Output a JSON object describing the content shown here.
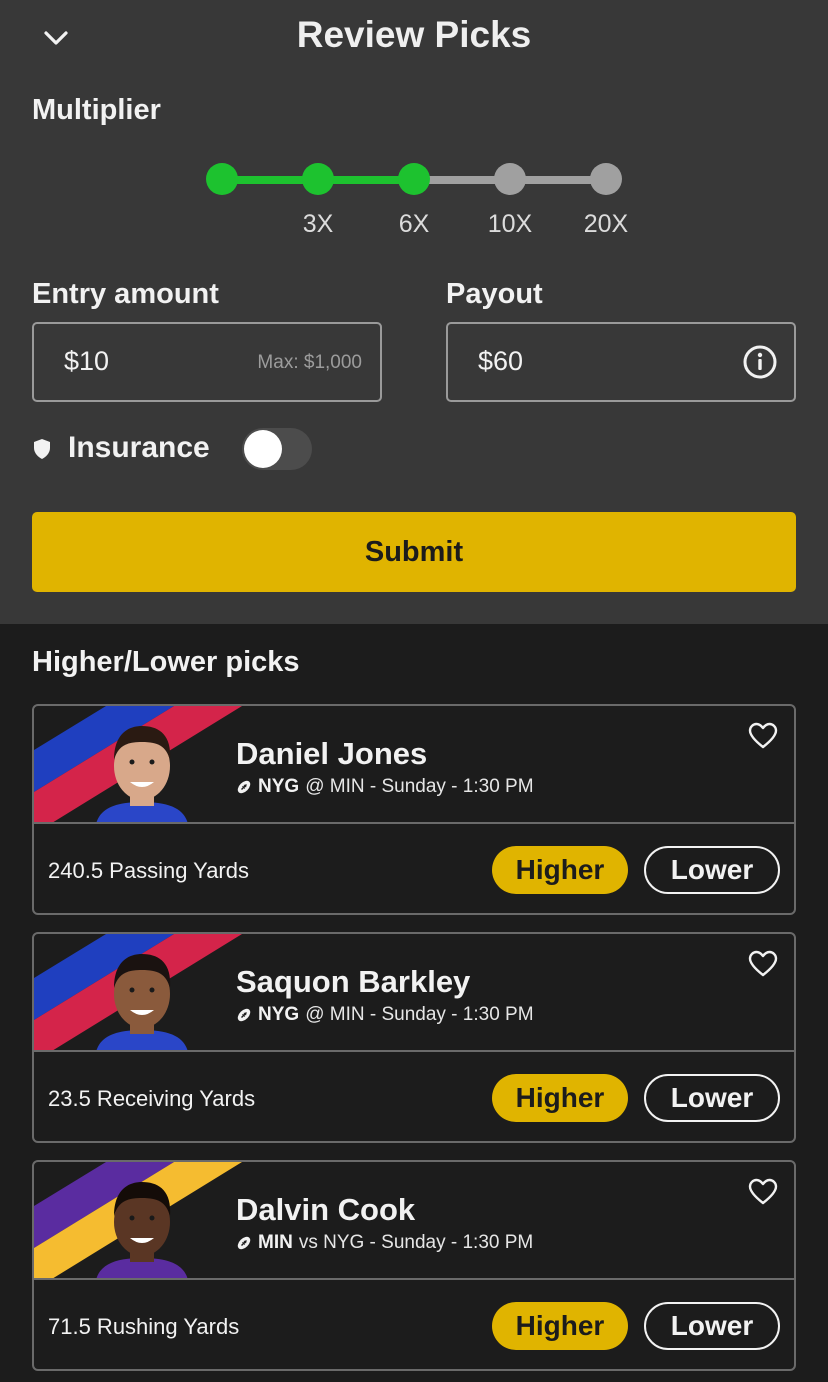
{
  "header": {
    "title": "Review Picks",
    "collapse_icon": "chevron-down-icon"
  },
  "multiplier": {
    "label": "Multiplier",
    "steps": [
      {
        "label": "",
        "active": true
      },
      {
        "label": "3X",
        "active": true
      },
      {
        "label": "6X",
        "active": true
      },
      {
        "label": "10X",
        "active": false
      },
      {
        "label": "20X",
        "active": false
      }
    ],
    "selected": "6X",
    "active_color": "#1dc22f",
    "inactive_color": "#a0a0a0"
  },
  "entry": {
    "label": "Entry amount",
    "value": "$10",
    "hint": "Max: $1,000"
  },
  "payout": {
    "label": "Payout",
    "value": "$60",
    "info_icon": "info-icon"
  },
  "insurance": {
    "label": "Insurance",
    "icon": "shield-icon",
    "enabled": false
  },
  "submit": {
    "label": "Submit",
    "color": "#e0b400"
  },
  "picks": {
    "title": "Higher/Lower picks",
    "items": [
      {
        "player": "Daniel Jones",
        "team": "NYG",
        "matchup_rest": "@ MIN - Sunday - 1:30 PM",
        "stat": "240.5 Passing Yards",
        "stripe_colors": [
          "#1f3fbf",
          "#d4244a"
        ],
        "jersey_color": "#2a46c8",
        "skin_color": "#d8a88a",
        "hair_color": "#2a1a12",
        "higher_label": "Higher",
        "lower_label": "Lower"
      },
      {
        "player": "Saquon Barkley",
        "team": "NYG",
        "matchup_rest": "@ MIN - Sunday - 1:30 PM",
        "stat": "23.5 Receiving Yards",
        "stripe_colors": [
          "#1f3fbf",
          "#d4244a"
        ],
        "jersey_color": "#2a46c8",
        "skin_color": "#8a5a3c",
        "hair_color": "#1a1210",
        "higher_label": "Higher",
        "lower_label": "Lower"
      },
      {
        "player": "Dalvin Cook",
        "team": "MIN",
        "matchup_rest": "vs NYG - Sunday - 1:30 PM",
        "stat": "71.5 Rushing Yards",
        "stripe_colors": [
          "#5a2ca0",
          "#f5bc30"
        ],
        "jersey_color": "#5a2ca0",
        "skin_color": "#5a3624",
        "hair_color": "#140c08",
        "higher_label": "Higher",
        "lower_label": "Lower"
      }
    ]
  }
}
